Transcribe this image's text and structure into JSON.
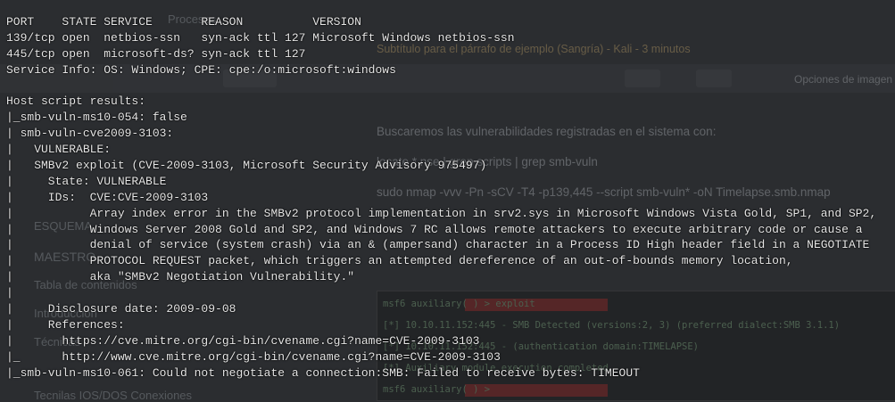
{
  "background": {
    "tab_title": "Procesos",
    "link_text": "Subtítulo para el párrafo de ejemplo (Sangría) - Kali - 3 minutos",
    "image_options": "Opciones de imagen",
    "sidebar": [
      "ESQUEMA",
      "MAESTRO",
      "Tabla de contenidos",
      "Introducción",
      "Técnicas",
      "Tecnilas IOS/DOS Conexiones"
    ],
    "doc_lines": [
      "Buscaremos las vulnerabilidades registradas en el sistema con:",
      "locate *.nse | grep scripts | grep smb-vuln",
      "sudo nmap -vvv -Pn -sCV -T4 -p139,445 --script smb-vuln* -oN Timelapse.smb.nmap"
    ],
    "embedded_terminal": [
      "msf6 auxiliary(                    ) > exploit",
      "[*] 10.10.11.152:445  - SMB Detected (versions:2, 3) (preferred dialect:SMB 3.1.1)",
      "[*] 10.10.11.152:445  - (authentication domain:TIMELAPSE)",
      "[*] Auxiliary module execution completed",
      "msf6 auxiliary(                    ) > "
    ]
  },
  "terminal": {
    "lines": [
      "PORT    STATE SERVICE       REASON          VERSION",
      "139/tcp open  netbios-ssn   syn-ack ttl 127 Microsoft Windows netbios-ssn",
      "445/tcp open  microsoft-ds? syn-ack ttl 127",
      "Service Info: OS: Windows; CPE: cpe:/o:microsoft:windows",
      "",
      "Host script results:",
      "|_smb-vuln-ms10-054: false",
      "| smb-vuln-cve2009-3103:",
      "|   VULNERABLE:",
      "|   SMBv2 exploit (CVE-2009-3103, Microsoft Security Advisory 975497)",
      "|     State: VULNERABLE",
      "|     IDs:  CVE:CVE-2009-3103",
      "|           Array index error in the SMBv2 protocol implementation in srv2.sys in Microsoft Windows Vista Gold, SP1, and SP2,",
      "|           Windows Server 2008 Gold and SP2, and Windows 7 RC allows remote attackers to execute arbitrary code or cause a",
      "|           denial of service (system crash) via an & (ampersand) character in a Process ID High header field in a NEGOTIATE",
      "|           PROTOCOL REQUEST packet, which triggers an attempted dereference of an out-of-bounds memory location,",
      "|           aka \"SMBv2 Negotiation Vulnerability.\"",
      "|",
      "|     Disclosure date: 2009-09-08",
      "|     References:",
      "|       https://cve.mitre.org/cgi-bin/cvename.cgi?name=CVE-2009-3103",
      "|_      http://www.cve.mitre.org/cgi-bin/cvename.cgi?name=CVE-2009-3103",
      "|_smb-vuln-ms10-061: Could not negotiate a connection:SMB: Failed to receive bytes: TIMEOUT"
    ]
  }
}
